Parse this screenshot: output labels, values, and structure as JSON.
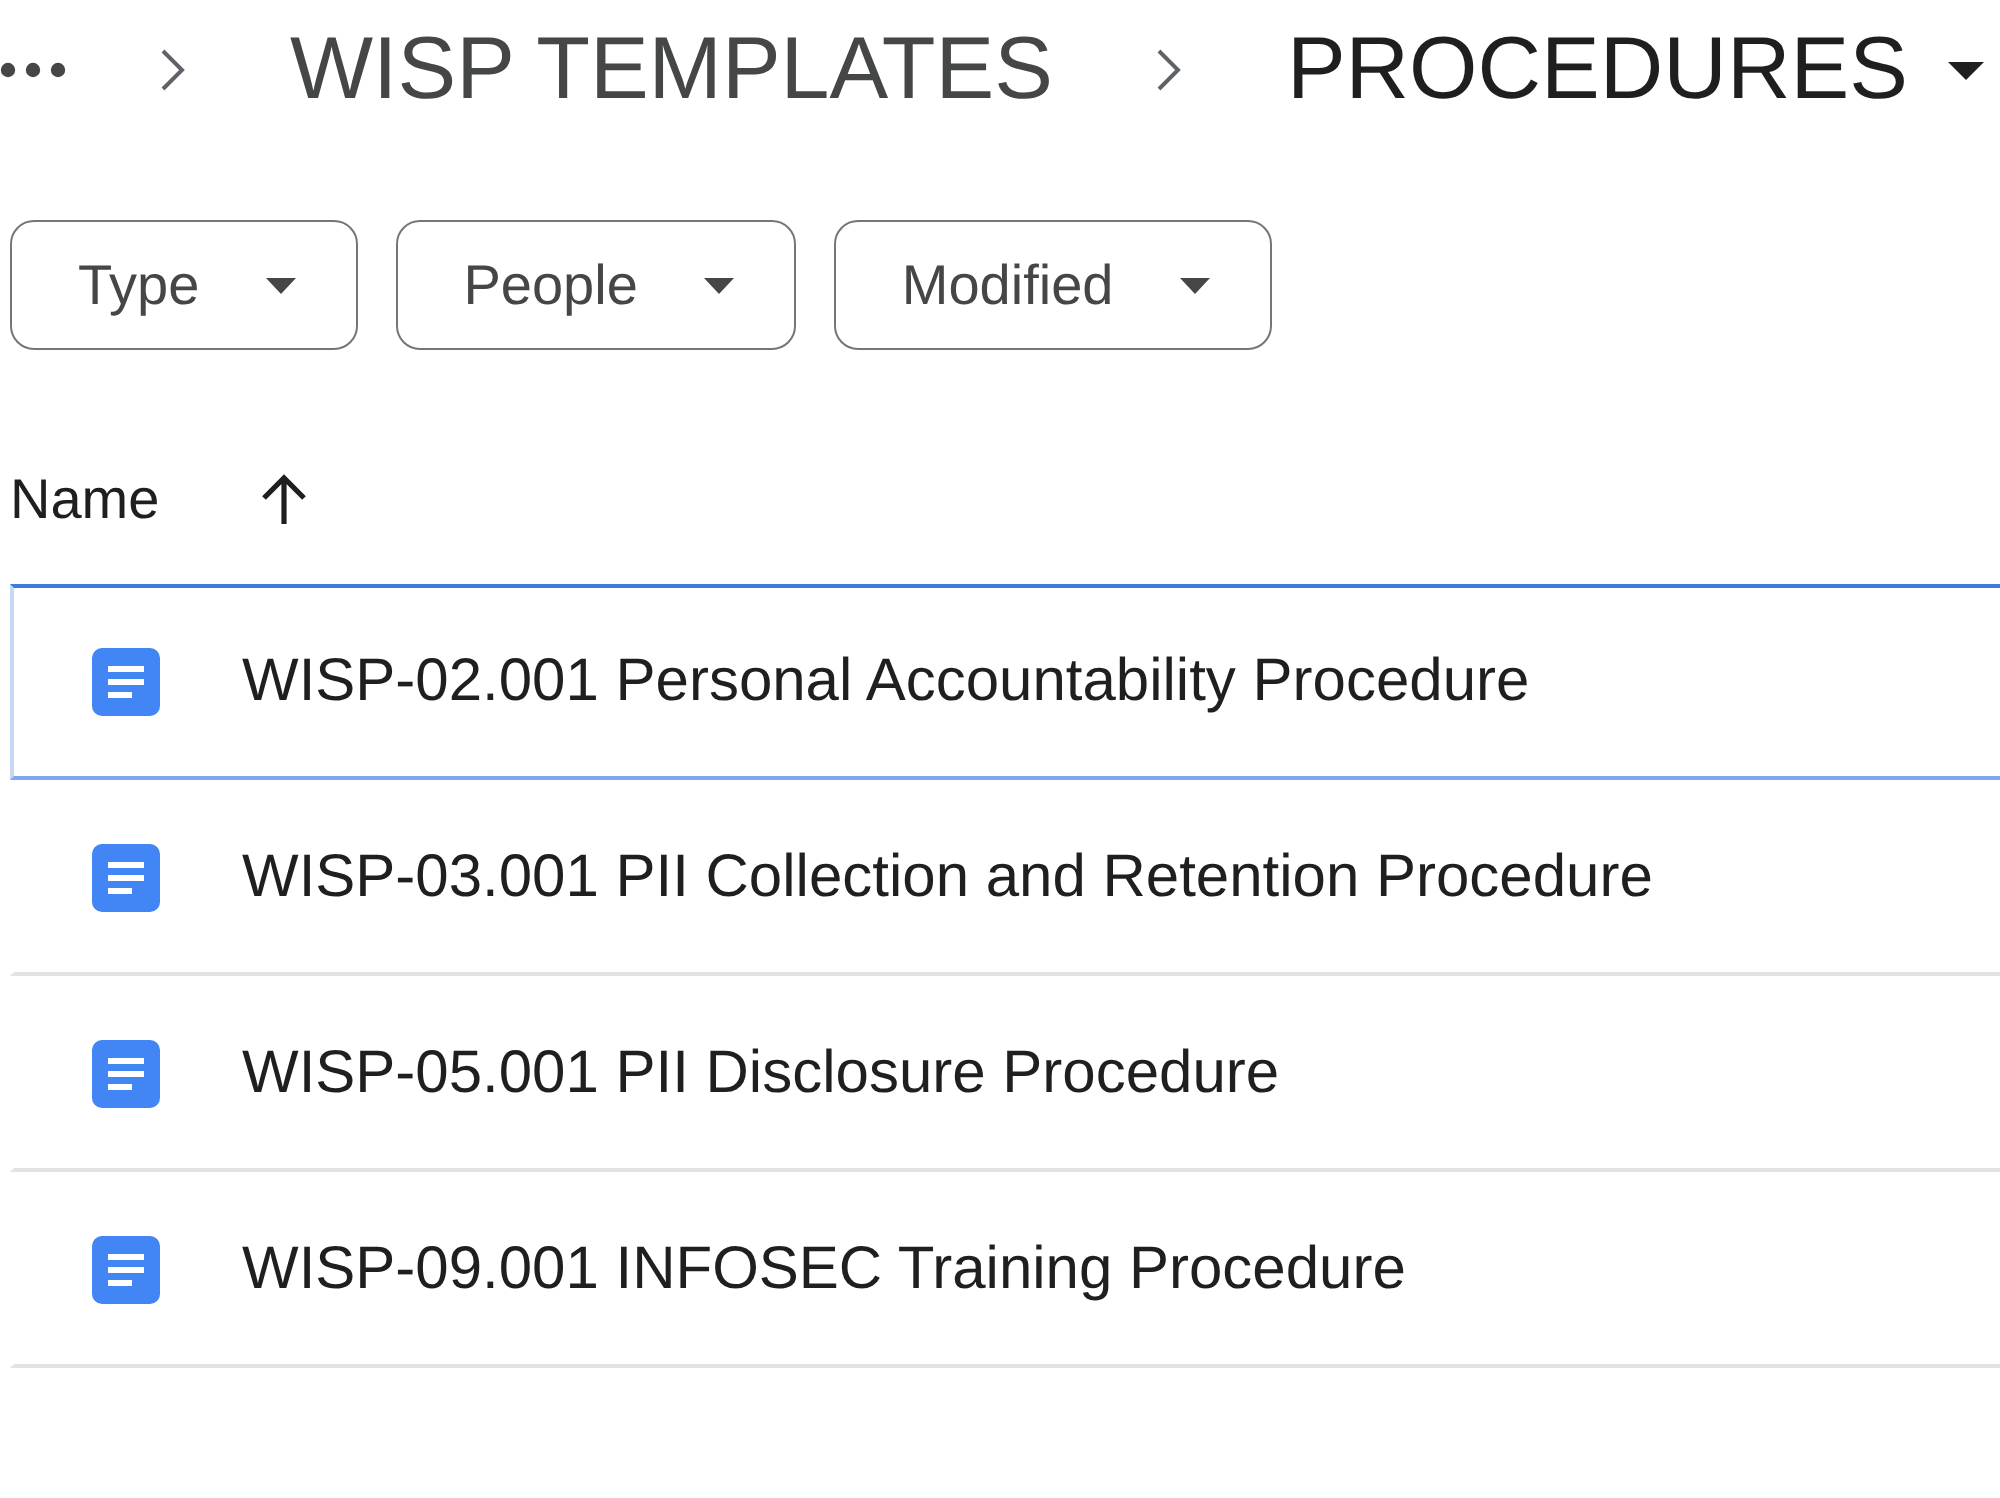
{
  "breadcrumb": {
    "items": [
      {
        "label": "WISP TEMPLATES",
        "current": false
      },
      {
        "label": "PROCEDURES",
        "current": true
      }
    ]
  },
  "filters": [
    {
      "label": "Type"
    },
    {
      "label": "People"
    },
    {
      "label": "Modified"
    }
  ],
  "table": {
    "columns": [
      {
        "label": "Name",
        "ascending": true
      }
    ],
    "rows": [
      {
        "name": "WISP-02.001 Personal Accountability Procedure",
        "selected": true
      },
      {
        "name": "WISP-03.001 PII Collection and Retention Procedure",
        "selected": false
      },
      {
        "name": "WISP-05.001 PII Disclosure Procedure",
        "selected": false
      },
      {
        "name": "WISP-09.001 INFOSEC Training Procedure",
        "selected": false
      }
    ]
  }
}
